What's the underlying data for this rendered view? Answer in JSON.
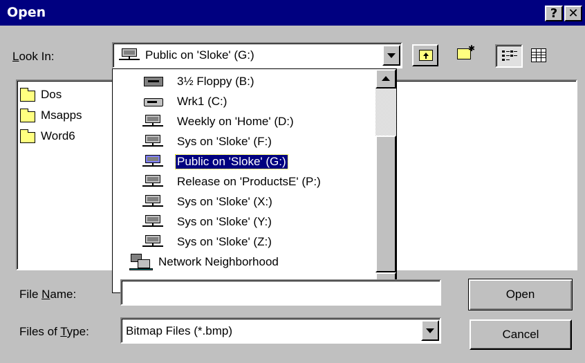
{
  "window": {
    "title": "Open",
    "help_glyph": "?",
    "close_glyph": "✕"
  },
  "look_in": {
    "label": "Look In:",
    "value": "Public on 'Sloke' (G:)"
  },
  "folders": [
    {
      "name": "Dos"
    },
    {
      "name": "Msapps"
    },
    {
      "name": "Word6"
    }
  ],
  "dropdown_items": [
    {
      "label": "3½ Floppy (B:)",
      "icon": "floppy-drive-icon"
    },
    {
      "label": "Wrk1 (C:)",
      "icon": "hard-drive-icon"
    },
    {
      "label": "Weekly on 'Home' (D:)",
      "icon": "network-drive-icon"
    },
    {
      "label": "Sys on 'Sloke' (F:)",
      "icon": "network-drive-icon"
    },
    {
      "label": "Public on 'Sloke' (G:)",
      "icon": "network-drive-icon",
      "selected": true
    },
    {
      "label": "Release on 'ProductsE' (P:)",
      "icon": "network-drive-icon"
    },
    {
      "label": "Sys on 'Sloke' (X:)",
      "icon": "network-drive-icon"
    },
    {
      "label": "Sys on 'Sloke' (Y:)",
      "icon": "network-drive-icon"
    },
    {
      "label": "Sys on 'Sloke' (Z:)",
      "icon": "network-drive-icon"
    },
    {
      "label": "Network Neighborhood",
      "icon": "network-neighborhood-icon"
    }
  ],
  "file_name": {
    "label": "File Name:",
    "value": ""
  },
  "file_type": {
    "label": "Files of Type:",
    "value": "Bitmap Files (*.bmp)"
  },
  "buttons": {
    "open": "Open",
    "cancel": "Cancel"
  },
  "toolbar": {
    "up_one_level": "up-one-level-icon",
    "new_folder": "new-folder-icon",
    "list_view": "list-view-icon",
    "details_view": "details-view-icon"
  }
}
